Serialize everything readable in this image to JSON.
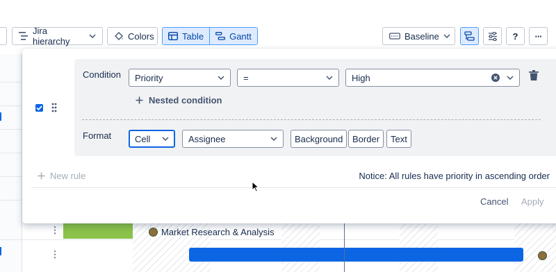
{
  "toolbar": {
    "hierarchy_label": "Jira hierarchy",
    "colors_label": "Colors",
    "table_label": "Table",
    "gantt_label": "Gantt",
    "baseline_label": "Baseline",
    "help_label": "?",
    "more_label": "···"
  },
  "rule": {
    "condition_label": "Condition",
    "field_value": "Priority",
    "operator_value": "=",
    "value_value": "High",
    "nested_condition_label": "Nested condition",
    "format_label": "Format",
    "target_value": "Cell",
    "assignee_value": "Assignee",
    "style_options": [
      "Background",
      "Border",
      "Text"
    ],
    "enabled": true
  },
  "footer": {
    "new_rule_label": "New rule",
    "notice_text": "Notice: All rules have priority in ascending order",
    "cancel_label": "Cancel",
    "apply_label": "Apply"
  },
  "gantt": {
    "task_label": "Market Research & Analysis"
  },
  "colors": {
    "accent": "#0c66e4",
    "selected_bg": "#deebff",
    "green_bar": "#8bc34a",
    "blue_bar": "#0c66e4"
  },
  "icons": [
    "hierarchy-icon",
    "paint-bucket-icon",
    "table-icon",
    "gantt-icon",
    "baseline-icon",
    "rule-highlight-icon",
    "sliders-icon",
    "help-icon",
    "more-icon",
    "chevron-down-icon",
    "clear-icon",
    "trash-icon",
    "plus-icon",
    "drag-handle-icon",
    "checkbox-icon",
    "cursor-icon"
  ]
}
